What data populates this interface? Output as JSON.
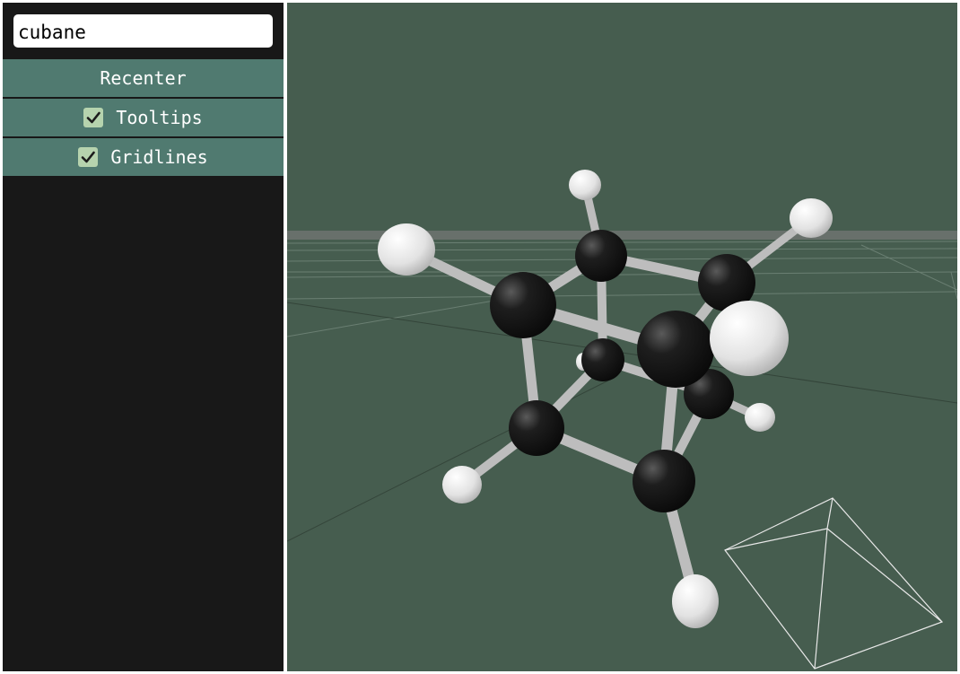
{
  "search": {
    "value": "cubane"
  },
  "sidebar": {
    "buttons": [
      {
        "label": "Recenter"
      },
      {
        "label": "Tooltips",
        "checked": true
      },
      {
        "label": "Gridlines",
        "checked": true
      }
    ]
  },
  "colors": {
    "sidebar_bg": "#181818",
    "button_bg": "#507a70",
    "checkbox_bg": "#b6d3ae",
    "viewport_bg": "#465d4f",
    "carbon": "#161616",
    "hydrogen": "#e6e6e6",
    "bond": "#bdbdbd"
  },
  "molecule": {
    "name": "cubane",
    "atoms": {
      "carbon": 8,
      "hydrogen": 8
    }
  }
}
